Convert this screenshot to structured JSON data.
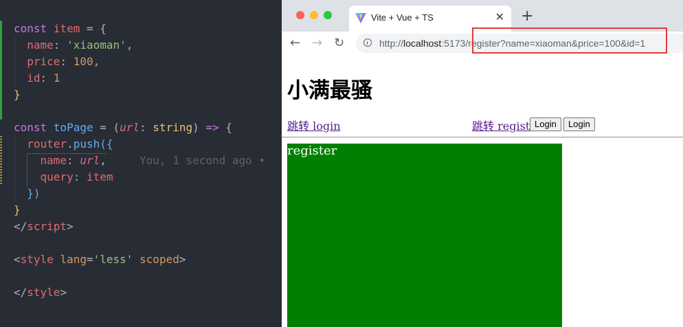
{
  "editor": {
    "lines": [
      {
        "tokens": [
          {
            "c": "kw",
            "t": "const "
          },
          {
            "c": "var",
            "t": "item"
          },
          {
            "c": "punc",
            "t": " = {"
          }
        ]
      },
      {
        "tokens": [
          {
            "c": "prop",
            "t": "  name"
          },
          {
            "c": "punc",
            "t": ": "
          },
          {
            "c": "str",
            "t": "'xiaoman'"
          },
          {
            "c": "punc",
            "t": ","
          }
        ]
      },
      {
        "tokens": [
          {
            "c": "prop",
            "t": "  price"
          },
          {
            "c": "punc",
            "t": ": "
          },
          {
            "c": "num",
            "t": "100"
          },
          {
            "c": "punc",
            "t": ","
          }
        ]
      },
      {
        "tokens": [
          {
            "c": "prop",
            "t": "  id"
          },
          {
            "c": "punc",
            "t": ": "
          },
          {
            "c": "num",
            "t": "1"
          }
        ]
      },
      {
        "tokens": [
          {
            "c": "type",
            "t": "}"
          }
        ]
      },
      {
        "tokens": []
      },
      {
        "tokens": [
          {
            "c": "kw",
            "t": "const "
          },
          {
            "c": "fn",
            "t": "toPage"
          },
          {
            "c": "punc",
            "t": " = ("
          },
          {
            "c": "param",
            "t": "url"
          },
          {
            "c": "punc",
            "t": ": "
          },
          {
            "c": "type",
            "t": "string"
          },
          {
            "c": "punc",
            "t": ") "
          },
          {
            "c": "kw",
            "t": "=>"
          },
          {
            "c": "punc",
            "t": " {"
          }
        ]
      },
      {
        "tokens": [
          {
            "c": "var",
            "t": "  router"
          },
          {
            "c": "punc",
            "t": "."
          },
          {
            "c": "fn",
            "t": "push"
          },
          {
            "c": "fn",
            "t": "({"
          }
        ]
      },
      {
        "tokens": [
          {
            "c": "prop",
            "t": "    name"
          },
          {
            "c": "punc",
            "t": ": "
          },
          {
            "c": "param",
            "t": "url"
          },
          {
            "c": "punc",
            "t": ","
          },
          {
            "c": "blame",
            "t": "     You, 1 second ago • "
          }
        ]
      },
      {
        "tokens": [
          {
            "c": "prop",
            "t": "    query"
          },
          {
            "c": "punc",
            "t": ": "
          },
          {
            "c": "var",
            "t": "item"
          }
        ]
      },
      {
        "tokens": [
          {
            "c": "fn",
            "t": "  })"
          }
        ]
      },
      {
        "tokens": [
          {
            "c": "type",
            "t": "}"
          }
        ]
      },
      {
        "tokens": [
          {
            "c": "punc",
            "t": "</"
          },
          {
            "c": "tag",
            "t": "script"
          },
          {
            "c": "punc",
            "t": ">"
          }
        ]
      },
      {
        "tokens": []
      },
      {
        "tokens": [
          {
            "c": "punc",
            "t": "<"
          },
          {
            "c": "tag",
            "t": "style "
          },
          {
            "c": "attr",
            "t": "lang"
          },
          {
            "c": "punc",
            "t": "="
          },
          {
            "c": "str",
            "t": "'less'"
          },
          {
            "c": "attr",
            "t": " scoped"
          },
          {
            "c": "punc",
            "t": ">"
          }
        ]
      },
      {
        "tokens": []
      },
      {
        "tokens": [
          {
            "c": "punc",
            "t": "</"
          },
          {
            "c": "tag",
            "t": "style"
          },
          {
            "c": "punc",
            "t": ">"
          }
        ]
      }
    ]
  },
  "browser": {
    "tab_title": "Vite + Vue + TS",
    "tab_close": "✕",
    "new_tab": "+",
    "back": "←",
    "forward": "→",
    "reload": "↻",
    "url_prefix": "http://",
    "url_host": "localhost",
    "url_rest": ":5173/register?name=xiaoman&price=100&id=1",
    "traffic_colors": [
      "#ff5f57",
      "#febc2e",
      "#28c840"
    ]
  },
  "page": {
    "heading": "小满最骚",
    "link_login": "跳转 login",
    "link_register": "跳转 register",
    "button1": "Login",
    "button2": "Login",
    "view_text": "register"
  },
  "colors": {
    "highlight": "#e53935",
    "view_bg": "#008000"
  }
}
